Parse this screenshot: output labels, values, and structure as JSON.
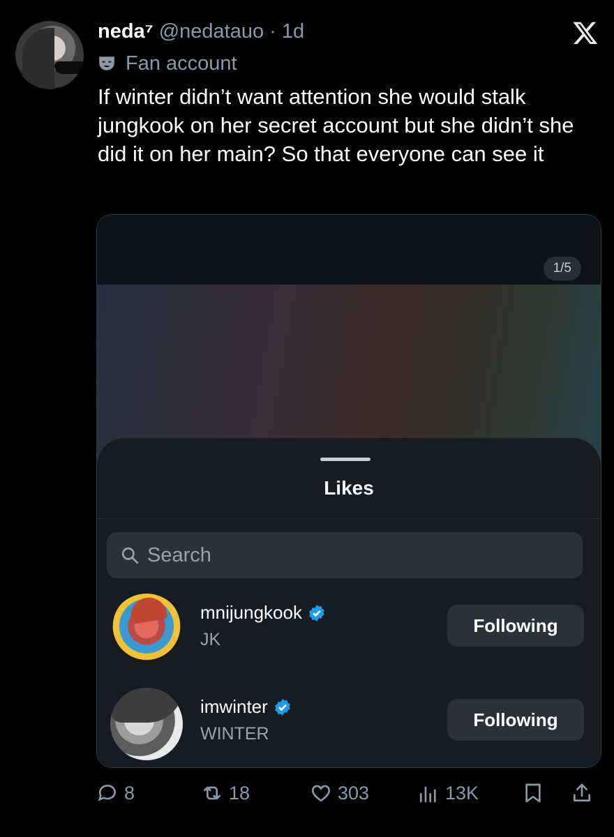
{
  "tweet": {
    "display_name": "neda⁷",
    "handle": "@nedatauo",
    "time": "· 1d",
    "label": "Fan account",
    "text": "If winter didn’t want attention she would stalk jungkook on her secret account but she didn’t she did it on her main? So that everyone can see it"
  },
  "media": {
    "counter": "1/5",
    "sheet_title": "Likes",
    "search_placeholder": "Search",
    "users": [
      {
        "username": "mnijungkook",
        "display_name": "JK",
        "button_label": "Following"
      },
      {
        "username": "imwinter",
        "display_name": "WINTER",
        "button_label": "Following"
      }
    ]
  },
  "actions": {
    "replies": "8",
    "reposts": "18",
    "likes": "303",
    "views": "13K"
  },
  "colors": {
    "background": "#000000",
    "text": "#e7e9ea",
    "muted": "#8b98a5",
    "verified": "#1d9bf0",
    "sheet": "#171c22"
  },
  "icons": [
    "x-logo-icon",
    "mask-icon",
    "search-icon",
    "verified-badge-icon",
    "reply-icon",
    "repost-icon",
    "like-icon",
    "views-icon",
    "bookmark-icon",
    "share-icon"
  ]
}
